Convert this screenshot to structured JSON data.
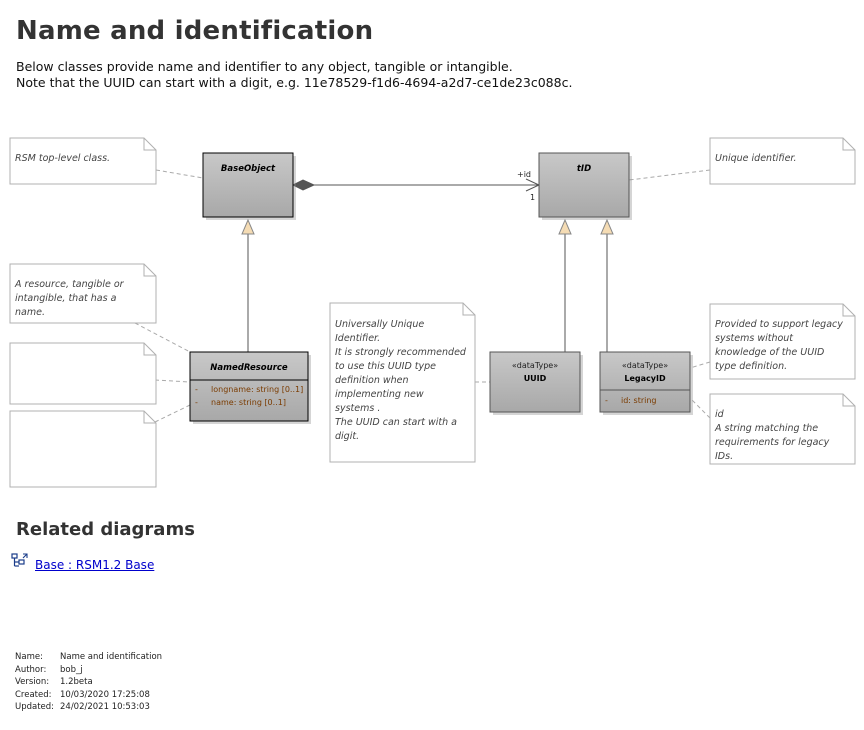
{
  "page": {
    "title": "Name and identification",
    "intro_line1": "Below classes provide name and identifier to any object, tangible or intangible.",
    "intro_line2": "Note that the UUID can start with a digit, e.g. 11e78529-f1d6-4694-a2d7-ce1de23c088c."
  },
  "diagram": {
    "notes": {
      "rsm_top_level": [
        "RSM top-level class."
      ],
      "unique_identifier": [
        "Unique identifier."
      ],
      "resource": [
        "A resource, tangible or",
        "intangible, that has a",
        "name."
      ],
      "uuid": [
        "Universally Unique",
        "Identifier.",
        "It is strongly recommended",
        "to use this UUID type",
        "definition when",
        "implementing new",
        "systems .",
        "The UUID can start with a",
        "digit."
      ],
      "legacy": [
        "Provided to support legacy",
        "systems without",
        "knowledge of the UUID",
        "type definition."
      ],
      "legacy_id": [
        "id",
        "A string matching the",
        "requirements for legacy",
        "IDs."
      ]
    },
    "classes": {
      "base_object": {
        "name": "BaseObject"
      },
      "tid": {
        "name": "tID"
      },
      "named_resource": {
        "name": "NamedResource",
        "attr1": "longname: string [0..1]",
        "attr2": "name: string [0..1]"
      },
      "uuid": {
        "stereotype": "«dataType»",
        "name": "UUID"
      },
      "legacy_id": {
        "stereotype": "«dataType»",
        "name": "LegacyID",
        "attr1": "id: string"
      }
    },
    "association": {
      "role": "+id",
      "multiplicity": "1"
    },
    "colors": {
      "class_fill": "#b4b4b4",
      "note_border": "#b0b0b0",
      "generalization_fill": "#f5dcb4",
      "link": "#0000cc"
    }
  },
  "related": {
    "heading": "Related diagrams",
    "link": "Base : RSM1.2 Base",
    "icon": "diagram-icon"
  },
  "meta": {
    "name_label": "Name:",
    "name_value": "Name and identification",
    "author_label": "Author:",
    "author_value": "bob_j",
    "version_label": "Version:",
    "version_value": "1.2beta",
    "created_label": "Created:",
    "created_value": "10/03/2020 17:25:08",
    "updated_label": "Updated:",
    "updated_value": "24/02/2021 10:53:03"
  }
}
